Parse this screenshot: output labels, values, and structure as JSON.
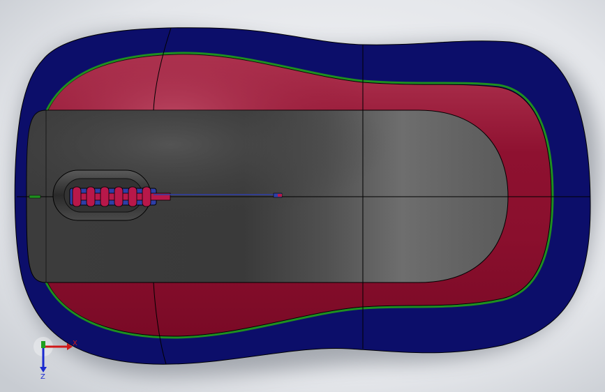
{
  "scene": {
    "background_colors": [
      "#f2f3f5",
      "#b8bdc4"
    ],
    "model_colors": {
      "outer_shell": "#0c0e6a",
      "red_shell": "#8e1130",
      "red_highlight": "#b13552",
      "green_seam": "#1f8f1f",
      "top_panel": "#3a3a3a",
      "top_panel_light": "#6a6a6a",
      "wheel_well": "#2a2a2a",
      "wheel_blue": "#2e3fa8",
      "wheel_red": "#b8184a",
      "edge_line": "#000000"
    }
  },
  "triad": {
    "x_label": "X",
    "z_label": "Z",
    "x_color": "#d01818",
    "y_color": "#20a020",
    "z_color": "#1a2ad0"
  }
}
